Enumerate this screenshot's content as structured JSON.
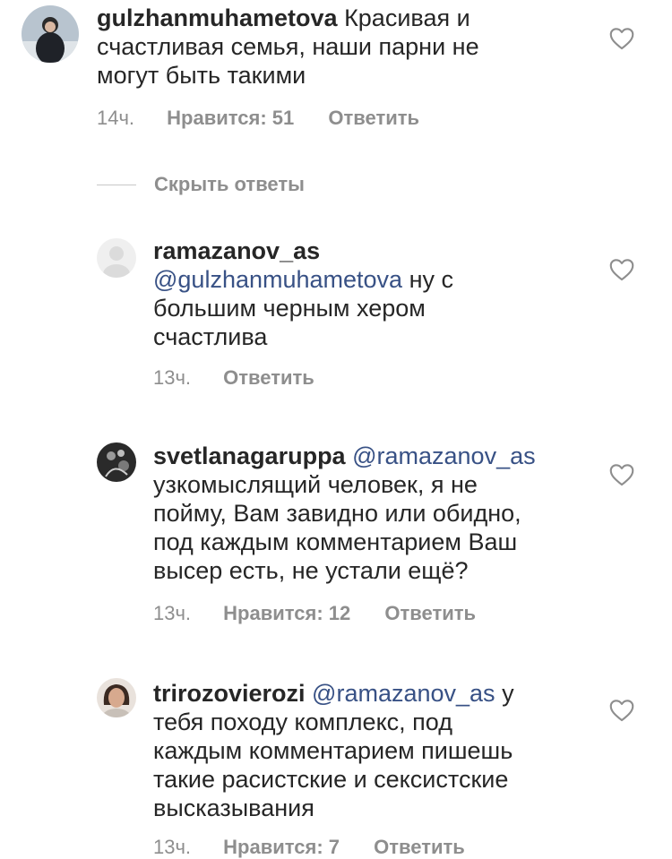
{
  "comments": [
    {
      "username": "gulzhanmuhametova",
      "lines": [
        "Красивая и",
        "счастливая семья, наши парни не",
        "могут быть такими"
      ],
      "time": "14ч.",
      "likes": "Нравится: 51",
      "reply": "Ответить"
    },
    {
      "username": "ramazanov_as",
      "mention": "@gulzhanmuhametova",
      "lines": [
        "ну с",
        "большим черным хером",
        "счастлива"
      ],
      "time": "13ч.",
      "reply": "Ответить"
    },
    {
      "username": "svetlanagaruppa",
      "mention": "@ramazanov_as",
      "lines": [
        "узкомыслящий человек, я не",
        "пойму, Вам завидно или обидно,",
        "под каждым комментарием Ваш",
        "высер есть, не устали ещё?"
      ],
      "time": "13ч.",
      "likes": "Нравится: 12",
      "reply": "Ответить"
    },
    {
      "username": "trirozovierozi",
      "mention": "@ramazanov_as",
      "lines": [
        "у",
        "тебя походу комплекс, под",
        "каждым комментарием пишешь",
        "такие расистские и сексистские",
        "высказывания"
      ],
      "time": "13ч.",
      "likes": "Нравится: 7",
      "reply": "Ответить"
    }
  ],
  "hide_replies_label": "Скрыть ответы",
  "icons": {
    "like": "heart-outline-icon",
    "avatar_placeholder": "default-avatar-icon"
  },
  "colors": {
    "text": "#262626",
    "mention": "#385185",
    "secondary": "#8e8e8e",
    "heart": "#8e8e8e"
  }
}
